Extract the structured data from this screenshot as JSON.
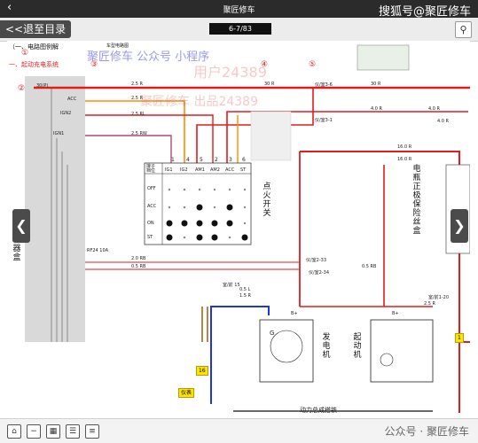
{
  "titlebar": {
    "back": "‹",
    "title": "聚匠修车"
  },
  "watermark_top": "搜狐号@聚匠修车",
  "toolbar": {
    "back_label": "<<退至目录",
    "page": "6-7/83",
    "search_icon": "search-icon"
  },
  "doc": {
    "section_title": "（一、电路图例解",
    "subsection": "一、起动充电系统",
    "header_hint": "车型电路图",
    "wm1": "聚匠修车 公众号 小程序",
    "wm2": "用户24389",
    "wm3": "聚匠修车 出品24389",
    "callouts": [
      "①",
      "②",
      "③",
      "④",
      "⑤"
    ],
    "wire_labels": [
      "2.5 R",
      "30 R",
      "30 R",
      "4.0 R",
      "4.0 R",
      "2.5 R",
      "2.5 RL",
      "2.5 RW",
      "4.0 R",
      "16.0 R",
      "16.0 R",
      "2.0 RB",
      "0.5 RB",
      "0.5 RB",
      "2.5 R",
      "1.5 R",
      "0.5 L"
    ],
    "terms": [
      "30(P)",
      "ACC",
      "IGN2",
      "IGN1",
      "B+",
      "B+",
      "1",
      "2",
      "1",
      "2",
      "16",
      "1",
      "2"
    ],
    "connectors": [
      "仪/室3-6",
      "仪/室3-1",
      "仪/室2-33",
      "仪/室2-34",
      "室/前1-20",
      "室/前 15"
    ],
    "fuse": "RF24 10A",
    "box_vert": "仪表电器盒",
    "switch_vert": "点火开关",
    "gen_vert": "发电机",
    "starter_vert": "起动机",
    "fuse_box_vert": "电瓶正极保险丝盒",
    "switch_table": {
      "cols": [
        "IG1",
        "IG2",
        "AM1",
        "AM2",
        "ACC",
        "ST"
      ],
      "col_nums": [
        "1",
        "4",
        "5",
        "2",
        "3",
        "6"
      ],
      "rows": [
        "OFF",
        "ACC",
        "ON",
        "ST"
      ],
      "corner": "接子 档位"
    },
    "bottom_text": "动力总成搭铁",
    "yellow_tags": [
      "仪表",
      "1"
    ],
    "gen_labels": [
      "G"
    ],
    "ground_label": "搭铁"
  },
  "bottombar": {
    "icons": [
      "home-icon",
      "zoom-out-icon",
      "grid-icon",
      "menu-icon",
      "list-icon"
    ],
    "watermark": "公众号 · 聚匠修车"
  }
}
